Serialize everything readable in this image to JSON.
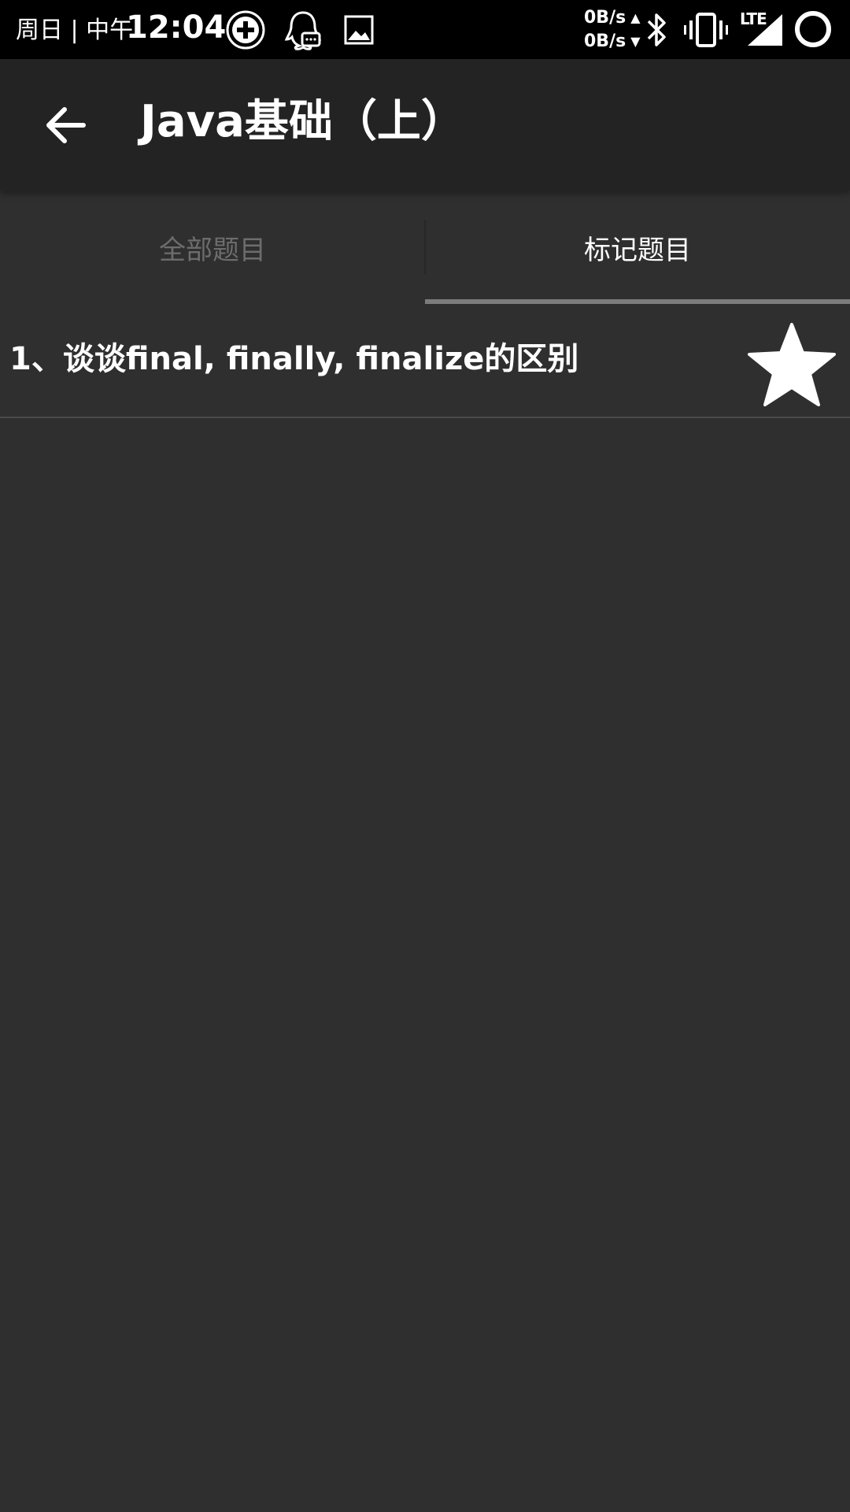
{
  "status_bar": {
    "day": "周日 | 中午",
    "time": "12:04",
    "upload_speed": "0B/s",
    "download_speed": "0B/s",
    "network": "LTE",
    "icons": [
      "add-circle-icon",
      "qq-icon",
      "image-icon",
      "bluetooth-icon",
      "vibrate-icon",
      "signal-icon",
      "circle-icon"
    ]
  },
  "toolbar": {
    "title": "Java基础（上）",
    "back_icon": "back-arrow-icon"
  },
  "tabs": [
    {
      "label": "全部题目",
      "selected": false
    },
    {
      "label": "标记题目",
      "selected": true
    }
  ],
  "questions": [
    {
      "text": "1、谈谈final, finally, finalize的区别",
      "starred": true,
      "icon": "star-icon"
    }
  ],
  "colors": {
    "background": "#2f2f2f",
    "toolbar": "#232323",
    "status_bar": "#000000",
    "inactive_tab": "#6d6d6d",
    "indicator": "#7c7c7c"
  }
}
